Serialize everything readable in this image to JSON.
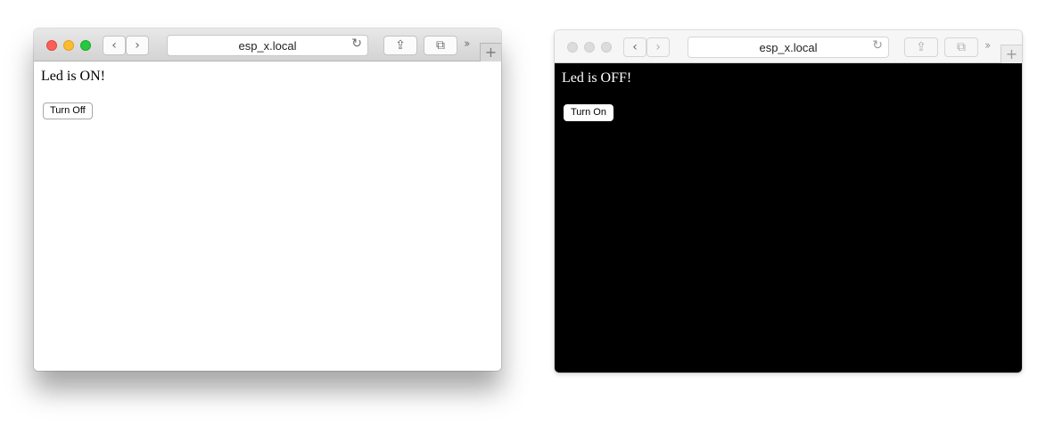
{
  "windows": [
    {
      "url": "esp_x.local",
      "heading": "Led is ON!",
      "button_label": "Turn Off"
    },
    {
      "url": "esp_x.local",
      "heading": "Led is OFF!",
      "button_label": "Turn On"
    }
  ],
  "icons": {
    "back": "‹",
    "forward": "›",
    "reload": "↻",
    "share": "⇪",
    "tabs": "⧉",
    "overflow": "››",
    "new_tab": "+"
  },
  "colors": {
    "close": "#fc5f57",
    "minimize": "#fdbc2e",
    "zoom": "#27c840",
    "inactive_light": "#dcdcdc",
    "page_on_bg": "#ffffff",
    "page_off_bg": "#000000"
  }
}
